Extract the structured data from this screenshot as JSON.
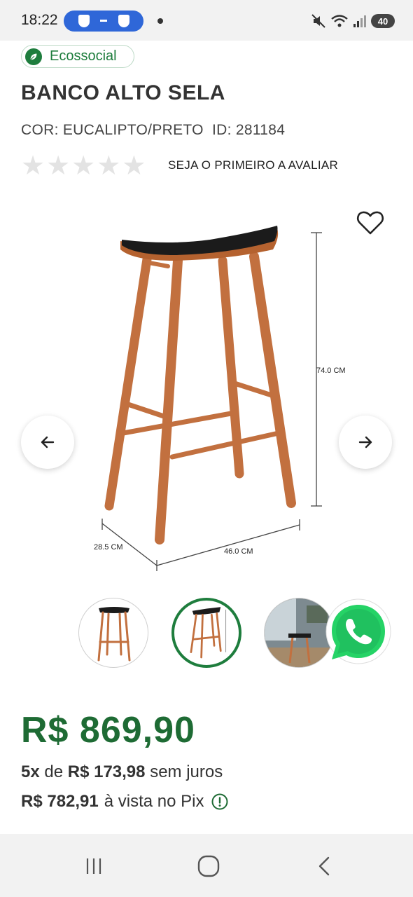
{
  "status_bar": {
    "time": "18:22",
    "battery": "40"
  },
  "badge": {
    "label": "Ecossocial"
  },
  "product": {
    "title": "BANCO ALTO SELA",
    "meta": "COR: EUCALIPTO/PRETO  ID: 281184",
    "rating": 0,
    "rating_max": 5,
    "review_cta": "SEJA O PRIMEIRO A AVALIAR"
  },
  "gallery": {
    "dimensions": {
      "height": "74.0 CM",
      "depth": "28.5 CM",
      "width": "46.0 CM"
    },
    "thumbnails": [
      "thumbnail-1",
      "thumbnail-2",
      "thumbnail-3"
    ],
    "selected_index": 1
  },
  "pricing": {
    "price": "R$ 869,90",
    "installments_count": "5x",
    "installments_of": "de",
    "installment_value": "R$ 173,98",
    "installments_suffix": "sem juros",
    "pix_value": "R$ 782,91",
    "pix_suffix": "à vista no Pix"
  },
  "colors": {
    "brand_green": "#1e7d3d",
    "price_green": "#1e6b34",
    "wood": "#c2703f",
    "seat": "#1b1b1b",
    "whatsapp": "#25d366"
  },
  "icons": {
    "favorite": "heart-outline-icon",
    "prev": "arrow-left-icon",
    "next": "arrow-right-icon",
    "chat": "whatsapp-icon",
    "badge": "leaf-icon",
    "pix_info": "info-icon",
    "nav_recents": "recents-icon",
    "nav_home": "home-icon",
    "nav_back": "back-icon"
  }
}
